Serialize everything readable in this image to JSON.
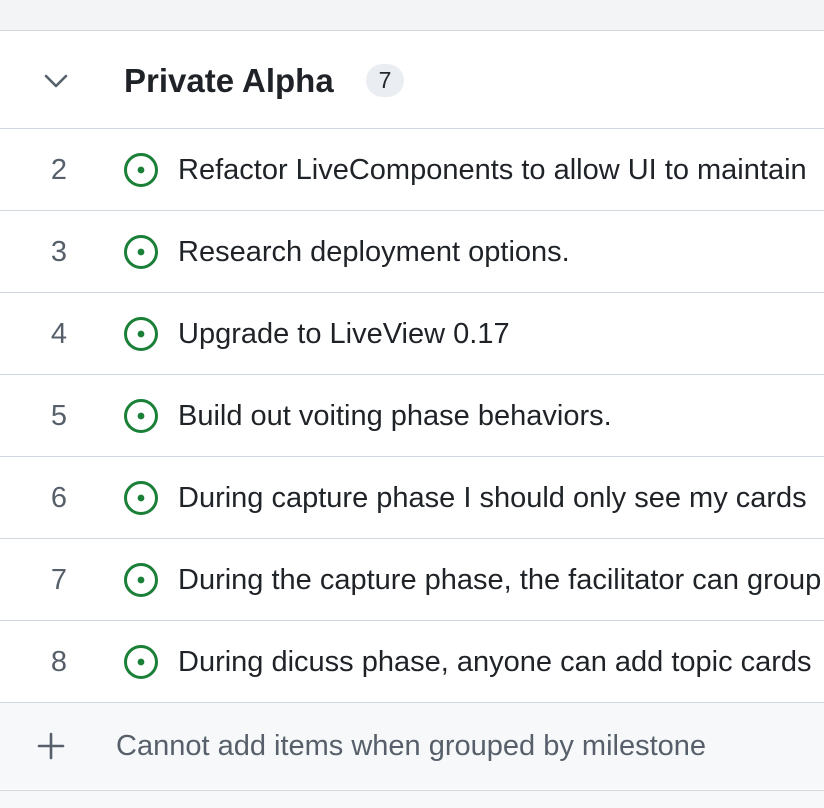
{
  "group": {
    "title": "Private Alpha",
    "count": "7",
    "toggle_icon": "chevron-down-icon"
  },
  "items": [
    {
      "number": "2",
      "title": "Refactor LiveComponents to allow UI to maintain",
      "status_icon": "issue-open-icon",
      "status_color": "#1a7f37"
    },
    {
      "number": "3",
      "title": "Research deployment options.",
      "status_icon": "issue-open-icon",
      "status_color": "#1a7f37"
    },
    {
      "number": "4",
      "title": "Upgrade to LiveView 0.17",
      "status_icon": "issue-open-icon",
      "status_color": "#1a7f37"
    },
    {
      "number": "5",
      "title": "Build out voiting phase behaviors.",
      "status_icon": "issue-open-icon",
      "status_color": "#1a7f37"
    },
    {
      "number": "6",
      "title": "During capture phase I should only see my cards",
      "status_icon": "issue-open-icon",
      "status_color": "#1a7f37"
    },
    {
      "number": "7",
      "title": "During the capture phase, the facilitator can group",
      "status_icon": "issue-open-icon",
      "status_color": "#1a7f37"
    },
    {
      "number": "8",
      "title": "During dicuss phase, anyone can add topic cards",
      "status_icon": "issue-open-icon",
      "status_color": "#1a7f37"
    }
  ],
  "footer": {
    "add_label": "Cannot add items when grouped by milestone",
    "add_icon": "plus-icon"
  },
  "colors": {
    "open_issue": "#1a7f37",
    "border": "#d0d7de",
    "muted_text": "#57606a"
  }
}
